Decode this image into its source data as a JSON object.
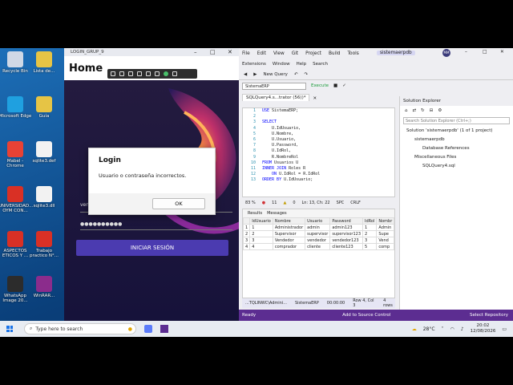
{
  "desktop": {
    "icons": [
      {
        "label": "Recycle Bin",
        "color": "#cfd8e6"
      },
      {
        "label": "Microsoft Edge",
        "color": "#1fa0e0"
      },
      {
        "label": "Mabel - Chrome",
        "color": "#e84235"
      },
      {
        "label": "UNIVERSIDAD... OYM CON...",
        "color": "#d93025"
      },
      {
        "label": "ASPECTOS ETICOS Y ...",
        "color": "#d93025"
      },
      {
        "label": "WhatsApp Image 20...",
        "color": "#2c2c2c"
      }
    ],
    "icons2": [
      {
        "label": "Lista de...",
        "color": "#e6c445"
      },
      {
        "label": "Guía",
        "color": "#e6c445"
      },
      {
        "label": "sqlite3.def",
        "color": "#f2f2f2"
      },
      {
        "label": "sqlite3.dll",
        "color": "#f2f2f2"
      },
      {
        "label": "Trabajo practico N°...",
        "color": "#d93025"
      },
      {
        "label": "WinRAR...",
        "color": "#8b2c8c"
      }
    ]
  },
  "login_app": {
    "title": "LOGIN_GRUP_9",
    "header": "Home",
    "username_label": "ven",
    "password_mask": "●●●●●●●●●●",
    "login_button": "INICIAR SESIÓN"
  },
  "dialog": {
    "title": "Login",
    "message": "Usuario o contraseña incorrectos.",
    "ok": "OK"
  },
  "vs": {
    "menu": [
      "File",
      "Edit",
      "View",
      "Git",
      "Project",
      "Build",
      "Tools"
    ],
    "solution_name": "sistemaerpdb",
    "menu2": [
      "Extensions",
      "Window",
      "Help",
      "Search"
    ],
    "new_query": "New Query",
    "db_select": "SistemaERP",
    "execute": "Execute",
    "tab": "SQLQuery4.s...trator (56))*",
    "code": [
      {
        "ln": "1",
        "t": "USE SistemaERP;"
      },
      {
        "ln": "2",
        "t": ""
      },
      {
        "ln": "3",
        "t": "SELECT"
      },
      {
        "ln": "4",
        "t": "    U.IdUsuario,"
      },
      {
        "ln": "5",
        "t": "    U.Nombre,"
      },
      {
        "ln": "6",
        "t": "    U.Usuario,"
      },
      {
        "ln": "7",
        "t": "    U.Password,"
      },
      {
        "ln": "8",
        "t": "    U.IdRol,"
      },
      {
        "ln": "9",
        "t": "    R.NombreRol"
      },
      {
        "ln": "10",
        "t": "FROM Usuarios U"
      },
      {
        "ln": "11",
        "t": "INNER JOIN Roles R"
      },
      {
        "ln": "12",
        "t": "    ON U.IdRol = R.IdRol"
      },
      {
        "ln": "13",
        "t": "ORDER BY U.IdUsuario;"
      }
    ],
    "zoom": "83 %",
    "errors": "11",
    "warnings": "0",
    "position": "Ln: 13, Ch: 22",
    "spc": "SPC",
    "crlf": "CRLF",
    "results_tabs": [
      "Results",
      "Messages"
    ],
    "columns": [
      "",
      "IdUsuario",
      "Nombre",
      "Usuario",
      "Password",
      "IdRol",
      "Nombr"
    ],
    "rows": [
      [
        "1",
        "1",
        "Administrador",
        "admin",
        "admin123",
        "1",
        "Admin"
      ],
      [
        "2",
        "2",
        "Supervisor",
        "supervisor",
        "supervisor123",
        "2",
        "Supe"
      ],
      [
        "3",
        "3",
        "Vendedor",
        "vendedor",
        "vendedor123",
        "3",
        "Vend"
      ],
      [
        "4",
        "4",
        "comprador",
        "cliente",
        "cliente123",
        "5",
        "comp"
      ]
    ],
    "qstatus": [
      "...TQLINWC\\Admini...",
      "SistemaERP",
      "00:00:00",
      "Row 4, Col 3",
      "4 rows"
    ],
    "status_ready": "Ready",
    "status_scc": "Add to Source Control",
    "status_repo": "Select Repository",
    "solution_explorer": {
      "title": "Solution Explorer",
      "search": "Search Solution Explorer (Ctrl+;)",
      "items": [
        {
          "text": "Solution 'sistemaerpdb' (1 of 1 project)",
          "indent": 0
        },
        {
          "text": "sistemaerpdb",
          "indent": 1
        },
        {
          "text": "Database References",
          "indent": 2
        },
        {
          "text": "Miscellaneous Files",
          "indent": 1
        },
        {
          "text": "SQLQuery4.sql",
          "indent": 2
        }
      ]
    }
  },
  "taskbar": {
    "search_placeholder": "Type here to search",
    "temp": "28°C",
    "time": "20:02",
    "date": "12/08/2026"
  }
}
